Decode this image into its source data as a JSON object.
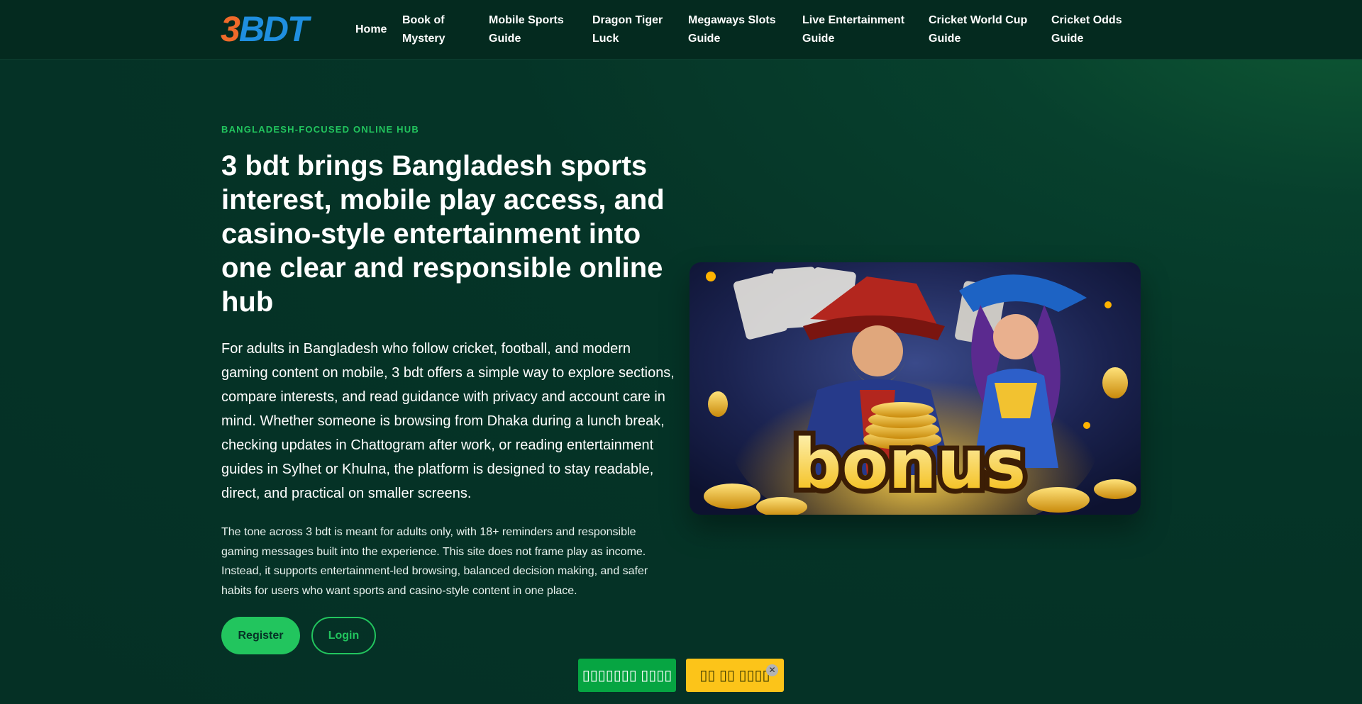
{
  "brand": {
    "logo_digit": "3",
    "logo_letters": "BDT"
  },
  "nav": {
    "items": [
      {
        "label": "Home"
      },
      {
        "label": "Book of Mystery"
      },
      {
        "label": "Mobile Sports Guide"
      },
      {
        "label": "Dragon Tiger Luck"
      },
      {
        "label": "Megaways Slots Guide"
      },
      {
        "label": "Live Entertainment Guide"
      },
      {
        "label": "Cricket World Cup Guide"
      },
      {
        "label": "Cricket Odds Guide"
      }
    ]
  },
  "hero": {
    "eyebrow": "BANGLADESH-FOCUSED ONLINE HUB",
    "title": "3 bdt brings Bangladesh sports interest, mobile play access, and casino-style entertainment into one clear and responsible online hub",
    "lead": "For adults in Bangladesh who follow cricket, football, and modern gaming content on mobile, 3 bdt offers a simple way to explore sections, compare interests, and read guidance with privacy and account care in mind. Whether someone is browsing from Dhaka during a lunch break, checking updates in Chattogram after work, or reading entertainment guides in Sylhet or Khulna, the platform is designed to stay readable, direct, and practical on smaller screens.",
    "body": "The tone across 3 bdt is meant for adults only, with 18+ reminders and responsible gaming messages built into the experience. This site does not frame play as income. Instead, it supports entertainment-led browsing, balanced decision making, and safer habits for users who want sports and casino-style content in one place.",
    "register_label": "Register",
    "login_label": "Login",
    "image_caption": "bonus"
  },
  "floating": {
    "left_label": "▯▯▯▯▯▯▯ ▯▯▯▯",
    "right_label": "▯▯ ▯▯ ▯▯▯▯",
    "close_glyph": "✕"
  },
  "colors": {
    "background": "#053226",
    "accent": "#22c55e",
    "logo_orange": "#f06a2a",
    "logo_blue": "#1f8fe0",
    "float_yellow": "#fcc419"
  }
}
